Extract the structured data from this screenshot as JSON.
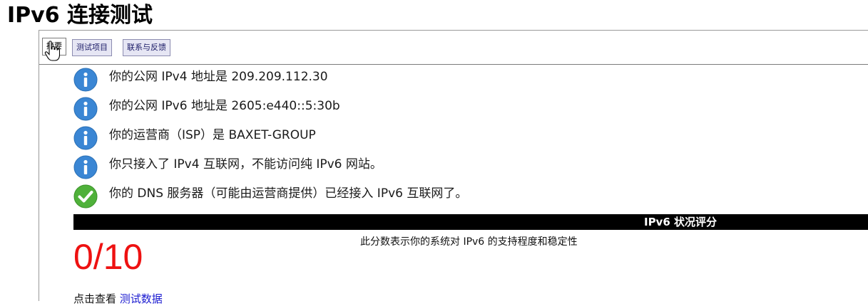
{
  "page": {
    "title": "IPv6 连接测试"
  },
  "tabs": [
    {
      "label": "摘要",
      "active": true
    },
    {
      "label": "测试项目",
      "active": false
    },
    {
      "label": "联系与反馈",
      "active": false
    }
  ],
  "messages": [
    {
      "icon": "info-icon",
      "text": "你的公网 IPv4 地址是 209.209.112.30"
    },
    {
      "icon": "info-icon",
      "text": "你的公网 IPv6 地址是 2605:e440::5:30b"
    },
    {
      "icon": "info-icon",
      "text": "你的运营商（ISP）是 BAXET-GROUP"
    },
    {
      "icon": "info-icon",
      "text": "你只接入了 IPv4 互联网，不能访问纯 IPv6 网站。"
    },
    {
      "icon": "check-icon",
      "text": "你的 DNS 服务器（可能由运营商提供）已经接入 IPv6 互联网了。"
    }
  ],
  "score": {
    "title": "IPv6 状况评分",
    "description": "此分数表示你的系统对 IPv6 的支持程度和稳定性",
    "value": "0/10"
  },
  "footer": {
    "prefix": "点击查看",
    "link_label": "测试数据"
  },
  "colors": {
    "info": "#3a86d4",
    "check": "#4fb13a",
    "score": "#ee1111",
    "link": "#1a1ad0"
  }
}
